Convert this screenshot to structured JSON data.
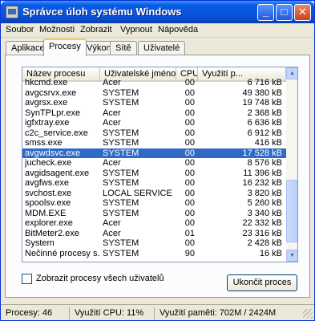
{
  "window": {
    "title": "Správce úloh systému Windows",
    "controls": {
      "minimize": "_",
      "maximize": "□",
      "close": "✕"
    }
  },
  "menu": [
    "Soubor",
    "Možnosti",
    "Zobrazit",
    "Vypnout",
    "Nápověda"
  ],
  "tabs": [
    {
      "label": "Aplikace",
      "active": false
    },
    {
      "label": "Procesy",
      "active": true
    },
    {
      "label": "Výkon",
      "active": false
    },
    {
      "label": "Sítě",
      "active": false
    },
    {
      "label": "Uživatelé",
      "active": false
    }
  ],
  "table": {
    "columns": [
      "Název procesu",
      "Uživatelské jméno",
      "CPU",
      "Využití p..."
    ],
    "rows": [
      {
        "name": "hkcmd.exe",
        "user": "Acer",
        "cpu": "00",
        "mem": "6 716 kB"
      },
      {
        "name": "avgcsrvx.exe",
        "user": "SYSTEM",
        "cpu": "00",
        "mem": "49 380 kB"
      },
      {
        "name": "avgrsx.exe",
        "user": "SYSTEM",
        "cpu": "00",
        "mem": "19 748 kB"
      },
      {
        "name": "SynTPLpr.exe",
        "user": "Acer",
        "cpu": "00",
        "mem": "2 368 kB"
      },
      {
        "name": "igfxtray.exe",
        "user": "Acer",
        "cpu": "00",
        "mem": "6 636 kB"
      },
      {
        "name": "c2c_service.exe",
        "user": "SYSTEM",
        "cpu": "00",
        "mem": "6 912 kB"
      },
      {
        "name": "smss.exe",
        "user": "SYSTEM",
        "cpu": "00",
        "mem": "416 kB"
      },
      {
        "name": "avgwdsvc.exe",
        "user": "SYSTEM",
        "cpu": "00",
        "mem": "17 528 kB",
        "selected": true
      },
      {
        "name": "jucheck.exe",
        "user": "Acer",
        "cpu": "00",
        "mem": "8 576 kB"
      },
      {
        "name": "avgidsagent.exe",
        "user": "SYSTEM",
        "cpu": "00",
        "mem": "11 396 kB"
      },
      {
        "name": "avgfws.exe",
        "user": "SYSTEM",
        "cpu": "00",
        "mem": "16 232 kB"
      },
      {
        "name": "svchost.exe",
        "user": "LOCAL SERVICE",
        "cpu": "00",
        "mem": "3 820 kB"
      },
      {
        "name": "spoolsv.exe",
        "user": "SYSTEM",
        "cpu": "00",
        "mem": "5 260 kB"
      },
      {
        "name": "MDM.EXE",
        "user": "SYSTEM",
        "cpu": "00",
        "mem": "3 340 kB"
      },
      {
        "name": "explorer.exe",
        "user": "Acer",
        "cpu": "00",
        "mem": "22 332 kB"
      },
      {
        "name": "BitMeter2.exe",
        "user": "Acer",
        "cpu": "01",
        "mem": "23 316 kB"
      },
      {
        "name": "System",
        "user": "SYSTEM",
        "cpu": "00",
        "mem": "2 428 kB"
      },
      {
        "name": "Nečinné procesy s...",
        "user": "SYSTEM",
        "cpu": "90",
        "mem": "16 kB"
      }
    ]
  },
  "show_all_users_label": "Zobrazit procesy všech uživatelů",
  "end_process_label": "Ukončit proces",
  "status": {
    "processes": "Procesy: 46",
    "cpu": "Využití CPU: 11%",
    "memory": "Využití paměti: 702M / 2424M"
  }
}
